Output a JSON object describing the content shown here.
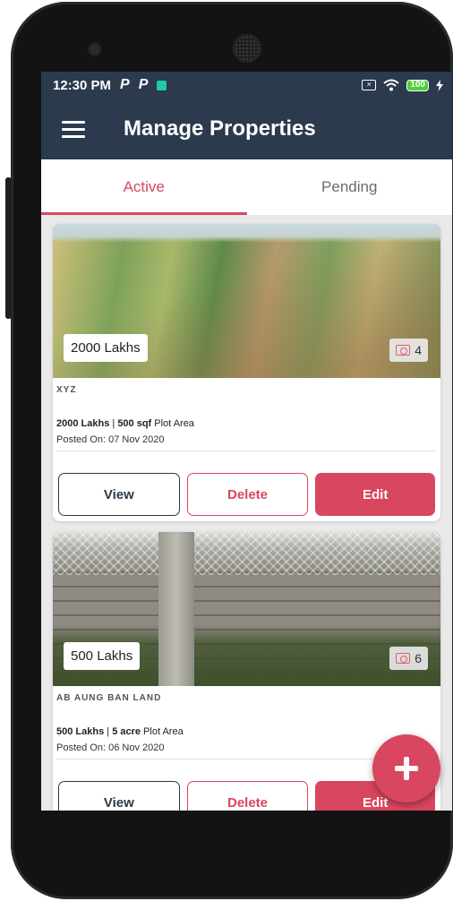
{
  "status_bar": {
    "time": "12:30 PM",
    "notif1": "P",
    "notif2": "P",
    "battery": "100"
  },
  "appbar": {
    "title": "Manage Properties",
    "menu_icon": "hamburger-menu-icon"
  },
  "tabs": [
    {
      "label": "Active",
      "selected": true
    },
    {
      "label": "Pending",
      "selected": false
    }
  ],
  "properties": [
    {
      "price_badge": "2000 Lakhs",
      "photo_count": "4",
      "name": "XYZ",
      "price": "2000 Lakhs",
      "separator": " | ",
      "area": "500 sqf",
      "area_label": " Plot Area",
      "posted": "Posted On: 07 Nov 2020"
    },
    {
      "price_badge": "500 Lakhs",
      "photo_count": "6",
      "name": "AB AUNG BAN LAND",
      "price": "500 Lakhs",
      "separator": " | ",
      "area": "5 acre",
      "area_label": " Plot Area",
      "posted": "Posted On: 06 Nov 2020"
    }
  ],
  "actions": {
    "view": "View",
    "delete": "Delete",
    "edit": "Edit"
  },
  "colors": {
    "primary": "#2b3a4d",
    "accent": "#d9465f"
  }
}
